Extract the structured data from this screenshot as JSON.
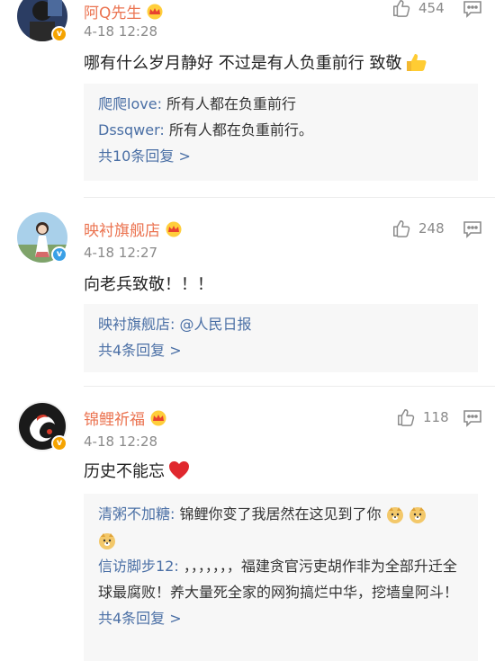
{
  "comments": [
    {
      "username": "阿Q先生",
      "time": "4-18 12:28",
      "likes": "454",
      "text": "哪有什么岁月静好 不过是有人负重前行 致敬",
      "replies": [
        {
          "user": "爬爬love",
          "sep": ": ",
          "text": "所有人都在负重前行"
        },
        {
          "user": "Dssqwer",
          "sep": ": ",
          "text": "所有人都在负重前行。"
        }
      ],
      "more": "共10条回复 >"
    },
    {
      "username": "映衬旗舰店",
      "time": "4-18 12:27",
      "likes": "248",
      "text": "向老兵致敬！！！",
      "replies": [
        {
          "user": "映衬旗舰店",
          "sep": ": ",
          "text": "@人民日报"
        }
      ],
      "more": "共4条回复 >"
    },
    {
      "username": "锦鲤祈福",
      "time": "4-18 12:28",
      "likes": "118",
      "text": "历史不能忘",
      "replies": [
        {
          "user": "清粥不加糖",
          "sep": ": ",
          "text": "锦鲤你变了我居然在这见到了你"
        },
        {
          "user": "信访脚步12",
          "sep": ": ",
          "text": "，，，，，，，福建贪官污吏胡作非为全部升迁全球最腐败！养大量死全家的网狗搞烂中华，挖墙皇阿斗！"
        }
      ],
      "more": "共4条回复 >"
    }
  ],
  "colors": {
    "username": "#eb7350",
    "reply_user": "#4a6fa5",
    "meta": "#8a8a8a",
    "reply_bg": "#f7f7f7"
  },
  "icons": {
    "like": "thumbs-up-icon",
    "reply": "comment-bubble-icon",
    "crown": "vip-crown-icon"
  }
}
